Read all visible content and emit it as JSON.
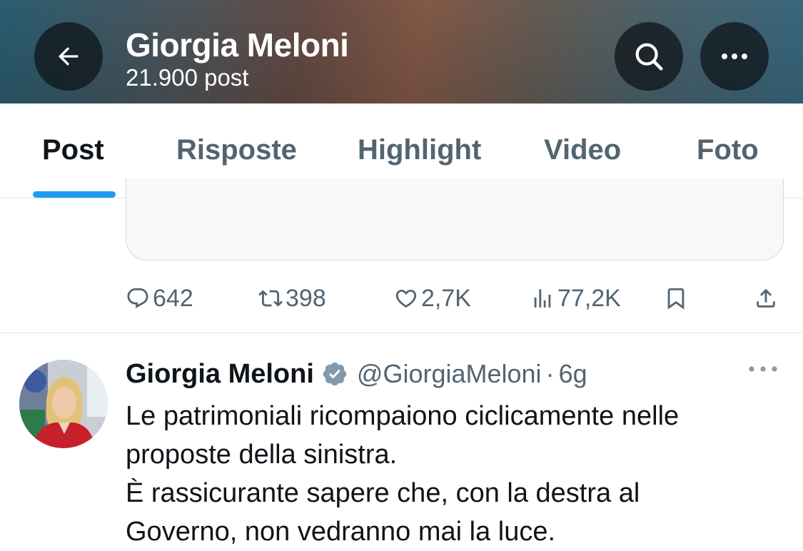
{
  "header": {
    "title": "Giorgia Meloni",
    "subtitle": "21.900 post",
    "back_icon": "arrow-left-icon",
    "search_icon": "search-icon",
    "more_icon": "more-horizontal-icon"
  },
  "tabs": [
    {
      "label": "Post",
      "active": true
    },
    {
      "label": "Risposte",
      "active": false
    },
    {
      "label": "Highlight",
      "active": false
    },
    {
      "label": "Video",
      "active": false
    },
    {
      "label": "Foto",
      "active": false
    }
  ],
  "previous_post": {
    "replies": "642",
    "reposts": "398",
    "likes": "2,7K",
    "views": "77,2K"
  },
  "tweet": {
    "name": "Giorgia Meloni",
    "handle": "@GiorgiaMeloni",
    "separator": "·",
    "time": "6g",
    "lines": [
      "Le patrimoniali ricompaiono ciclicamente nelle",
      "proposte della sinistra.",
      "È rassicurante sapere che, con la destra al",
      "Governo, non vedranno mai la luce."
    ]
  },
  "colors": {
    "accent": "#1d9bf0",
    "text": "#0f1419",
    "secondary": "#536471",
    "verified_badge": "#829aab"
  }
}
